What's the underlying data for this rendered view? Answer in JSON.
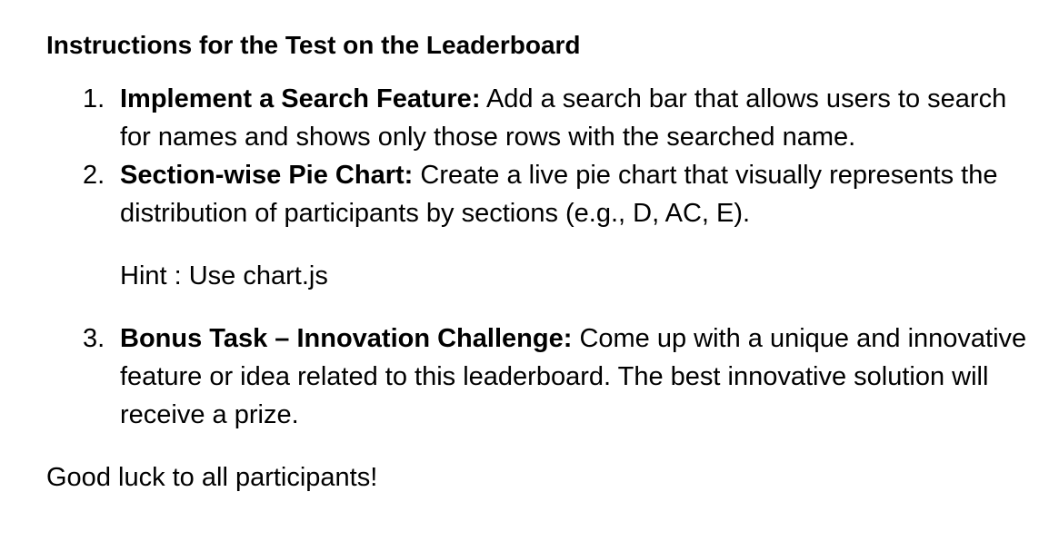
{
  "title": "Instructions for the Test on the Leaderboard",
  "tasks": [
    {
      "number": "1.",
      "heading": "Implement a Search Feature:",
      "text": "Add a search bar that allows users to search for names and shows only those rows with the searched name."
    },
    {
      "number": "2.",
      "heading": "Section-wise Pie Chart:",
      "text": "Create a live pie chart that visually represents the distribution of participants by sections (e.g., D, AC, E)."
    },
    {
      "number": "3.",
      "heading": "Bonus Task – Innovation Challenge:",
      "text": "Come up with a unique and innovative feature or idea related to this leaderboard. The best innovative solution will receive a prize."
    }
  ],
  "hint": "Hint : Use chart.js",
  "closing": "Good luck to all participants!"
}
